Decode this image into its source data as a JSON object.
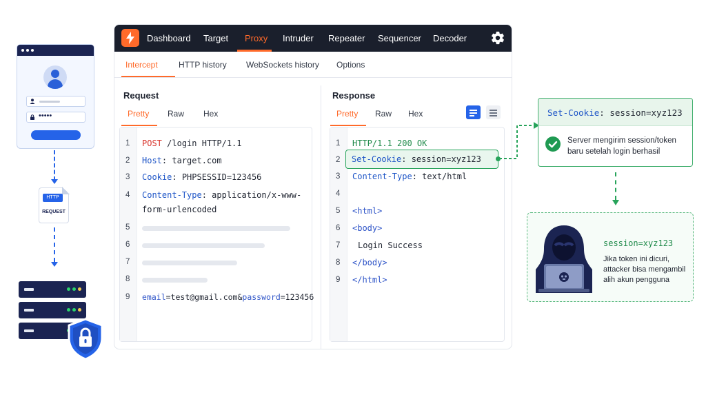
{
  "illustration": {
    "login_password_mask": "•••••",
    "http_tag": "HTTP",
    "http_request_label": "REQUEST"
  },
  "burp": {
    "nav": [
      "Dashboard",
      "Target",
      "Proxy",
      "Intruder",
      "Repeater",
      "Sequencer",
      "Decoder"
    ],
    "active_nav": "Proxy",
    "subtabs": [
      "Intercept",
      "HTTP history",
      "WebSockets history",
      "Options"
    ],
    "active_subtab": "Intercept",
    "request": {
      "title": "Request",
      "view_tabs": [
        "Pretty",
        "Raw",
        "Hex"
      ],
      "active_view": "Pretty",
      "line_numbers": [
        "1",
        "2",
        "3",
        "4",
        "5",
        "6",
        "7",
        "8",
        "9"
      ],
      "method": "POST",
      "request_line": "/login HTTP/1.1",
      "host_key": "Host",
      "host_value": "target.com",
      "cookie_key": "Cookie",
      "cookie_value": "PHPSESSID=123456",
      "ctype_key": "Content-Type",
      "ctype_value_1": "application/x-www-",
      "ctype_value_2": "form-urlencoded",
      "body_email_key": "email",
      "body_email_value": "=test@gmail.com&",
      "body_password_key": "password",
      "body_password_value": "=123456"
    },
    "response": {
      "title": "Response",
      "view_tabs": [
        "Pretty",
        "Raw",
        "Hex"
      ],
      "active_view": "Pretty",
      "line_numbers": [
        "1",
        "2",
        "3",
        "4",
        "5",
        "6",
        "7",
        "8",
        "9"
      ],
      "status_line": "HTTP/1.1 200 OK",
      "setcookie_key": "Set-Cookie",
      "setcookie_value": "session=xyz123",
      "ctype_key": "Content-Type",
      "ctype_value": "text/html",
      "html_open": "<html>",
      "body_open": "<body>",
      "body_text": "Login Success",
      "body_close": "</body>",
      "html_close": "</html>"
    }
  },
  "callout": {
    "setcookie_key": "Set-Cookie",
    "setcookie_value": "session=xyz123",
    "desc": "Server mengirim session/token baru setelah login berhasil"
  },
  "attacker": {
    "token": "session=xyz123",
    "desc": "Jika token ini dicuri, attacker bisa mengambil alih akun pengguna"
  },
  "colors": {
    "accent_orange": "#ff6a2a",
    "nav_bg": "#1a1f2c",
    "success_green": "#27a35a",
    "primary_blue": "#2563e8"
  }
}
